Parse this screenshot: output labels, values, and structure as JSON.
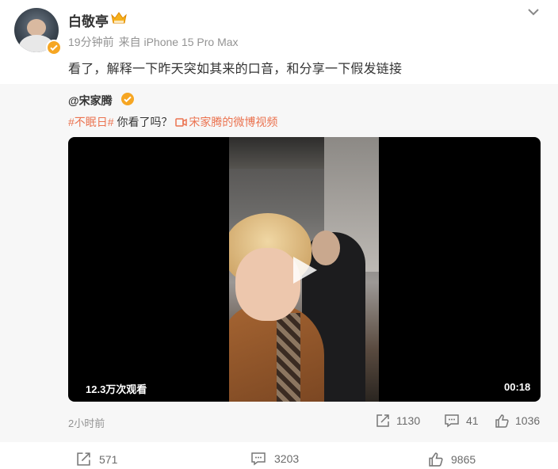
{
  "post": {
    "username": "白敬亭",
    "time": "19分钟前",
    "source": "来自 iPhone 15 Pro Max",
    "text": "看了，解释一下昨天突如其来的口音，和分享一下假发链接"
  },
  "repost": {
    "author": "@宋家腾",
    "hashtag": "#不眠日#",
    "text": " 你看了吗？",
    "video_link": "宋家腾的微博视频",
    "video": {
      "views": "12.3万次观看",
      "duration": "00:18"
    },
    "time": "2小时前",
    "stats": {
      "reposts": "1130",
      "comments": "41",
      "likes": "1036"
    }
  },
  "actions": {
    "reposts": "571",
    "comments": "3203",
    "likes": "9865"
  },
  "colors": {
    "accent": "#eb7350",
    "verified": "#f6a623",
    "muted": "#939393"
  },
  "icons": {
    "crown": "crown-icon",
    "verified": "verified-icon",
    "expand": "chevron-down-icon",
    "video": "video-camera-icon",
    "play": "play-icon",
    "repost": "repost-icon",
    "comment": "comment-icon",
    "like": "like-icon"
  }
}
